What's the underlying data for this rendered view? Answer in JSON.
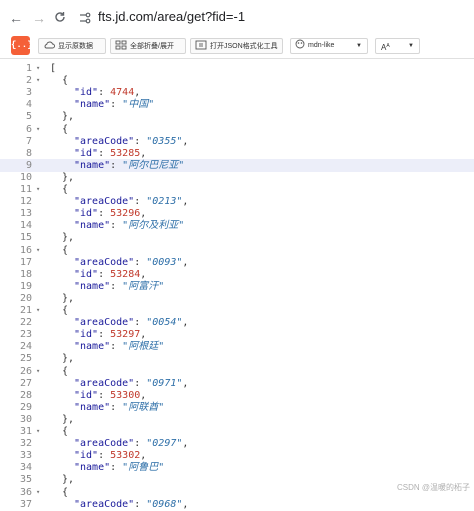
{
  "browser": {
    "url": "fts.jd.com/area/get?fid=-1"
  },
  "toolbar": {
    "logo_text": "{..}",
    "btn_raw": "显示原数据",
    "btn_fold": "全部折叠/展开",
    "btn_tool": "打开JSON格式化工具",
    "theme_select": "mdn-like",
    "font_select": "A"
  },
  "editor": {
    "lines": [
      {
        "n": "1",
        "fold": "▾",
        "ind": 0,
        "t": [
          {
            "c": "p",
            "v": "["
          }
        ]
      },
      {
        "n": "2",
        "fold": "▾",
        "ind": 1,
        "t": [
          {
            "c": "p",
            "v": "{"
          }
        ]
      },
      {
        "n": "3",
        "fold": "",
        "ind": 2,
        "t": [
          {
            "c": "k",
            "v": "\"id\""
          },
          {
            "c": "p",
            "v": ": "
          },
          {
            "c": "n",
            "v": "4744"
          },
          {
            "c": "p",
            "v": ","
          }
        ]
      },
      {
        "n": "4",
        "fold": "",
        "ind": 2,
        "t": [
          {
            "c": "k",
            "v": "\"name\""
          },
          {
            "c": "p",
            "v": ": "
          },
          {
            "c": "s",
            "v": "\"中国\""
          }
        ]
      },
      {
        "n": "5",
        "fold": "",
        "ind": 1,
        "t": [
          {
            "c": "p",
            "v": "},"
          }
        ]
      },
      {
        "n": "6",
        "fold": "▾",
        "ind": 1,
        "t": [
          {
            "c": "p",
            "v": "{"
          }
        ]
      },
      {
        "n": "7",
        "fold": "",
        "ind": 2,
        "t": [
          {
            "c": "k",
            "v": "\"areaCode\""
          },
          {
            "c": "p",
            "v": ": "
          },
          {
            "c": "s",
            "v": "\"0355\""
          },
          {
            "c": "p",
            "v": ","
          }
        ]
      },
      {
        "n": "8",
        "fold": "",
        "ind": 2,
        "t": [
          {
            "c": "k",
            "v": "\"id\""
          },
          {
            "c": "p",
            "v": ": "
          },
          {
            "c": "n",
            "v": "53285"
          },
          {
            "c": "p",
            "v": ","
          }
        ]
      },
      {
        "n": "9",
        "fold": "",
        "ind": 2,
        "hl": true,
        "t": [
          {
            "c": "k",
            "v": "\"name\""
          },
          {
            "c": "p",
            "v": ": "
          },
          {
            "c": "s",
            "v": "\"阿尔巴尼亚\""
          }
        ]
      },
      {
        "n": "10",
        "fold": "",
        "ind": 1,
        "t": [
          {
            "c": "p",
            "v": "},"
          }
        ]
      },
      {
        "n": "11",
        "fold": "▾",
        "ind": 1,
        "t": [
          {
            "c": "p",
            "v": "{"
          }
        ]
      },
      {
        "n": "12",
        "fold": "",
        "ind": 2,
        "t": [
          {
            "c": "k",
            "v": "\"areaCode\""
          },
          {
            "c": "p",
            "v": ": "
          },
          {
            "c": "s",
            "v": "\"0213\""
          },
          {
            "c": "p",
            "v": ","
          }
        ]
      },
      {
        "n": "13",
        "fold": "",
        "ind": 2,
        "t": [
          {
            "c": "k",
            "v": "\"id\""
          },
          {
            "c": "p",
            "v": ": "
          },
          {
            "c": "n",
            "v": "53296"
          },
          {
            "c": "p",
            "v": ","
          }
        ]
      },
      {
        "n": "14",
        "fold": "",
        "ind": 2,
        "t": [
          {
            "c": "k",
            "v": "\"name\""
          },
          {
            "c": "p",
            "v": ": "
          },
          {
            "c": "s",
            "v": "\"阿尔及利亚\""
          }
        ]
      },
      {
        "n": "15",
        "fold": "",
        "ind": 1,
        "t": [
          {
            "c": "p",
            "v": "},"
          }
        ]
      },
      {
        "n": "16",
        "fold": "▾",
        "ind": 1,
        "t": [
          {
            "c": "p",
            "v": "{"
          }
        ]
      },
      {
        "n": "17",
        "fold": "",
        "ind": 2,
        "t": [
          {
            "c": "k",
            "v": "\"areaCode\""
          },
          {
            "c": "p",
            "v": ": "
          },
          {
            "c": "s",
            "v": "\"0093\""
          },
          {
            "c": "p",
            "v": ","
          }
        ]
      },
      {
        "n": "18",
        "fold": "",
        "ind": 2,
        "t": [
          {
            "c": "k",
            "v": "\"id\""
          },
          {
            "c": "p",
            "v": ": "
          },
          {
            "c": "n",
            "v": "53284"
          },
          {
            "c": "p",
            "v": ","
          }
        ]
      },
      {
        "n": "19",
        "fold": "",
        "ind": 2,
        "t": [
          {
            "c": "k",
            "v": "\"name\""
          },
          {
            "c": "p",
            "v": ": "
          },
          {
            "c": "s",
            "v": "\"阿富汗\""
          }
        ]
      },
      {
        "n": "20",
        "fold": "",
        "ind": 1,
        "t": [
          {
            "c": "p",
            "v": "},"
          }
        ]
      },
      {
        "n": "21",
        "fold": "▾",
        "ind": 1,
        "t": [
          {
            "c": "p",
            "v": "{"
          }
        ]
      },
      {
        "n": "22",
        "fold": "",
        "ind": 2,
        "t": [
          {
            "c": "k",
            "v": "\"areaCode\""
          },
          {
            "c": "p",
            "v": ": "
          },
          {
            "c": "s",
            "v": "\"0054\""
          },
          {
            "c": "p",
            "v": ","
          }
        ]
      },
      {
        "n": "23",
        "fold": "",
        "ind": 2,
        "t": [
          {
            "c": "k",
            "v": "\"id\""
          },
          {
            "c": "p",
            "v": ": "
          },
          {
            "c": "n",
            "v": "53297"
          },
          {
            "c": "p",
            "v": ","
          }
        ]
      },
      {
        "n": "24",
        "fold": "",
        "ind": 2,
        "t": [
          {
            "c": "k",
            "v": "\"name\""
          },
          {
            "c": "p",
            "v": ": "
          },
          {
            "c": "s",
            "v": "\"阿根廷\""
          }
        ]
      },
      {
        "n": "25",
        "fold": "",
        "ind": 1,
        "t": [
          {
            "c": "p",
            "v": "},"
          }
        ]
      },
      {
        "n": "26",
        "fold": "▾",
        "ind": 1,
        "t": [
          {
            "c": "p",
            "v": "{"
          }
        ]
      },
      {
        "n": "27",
        "fold": "",
        "ind": 2,
        "t": [
          {
            "c": "k",
            "v": "\"areaCode\""
          },
          {
            "c": "p",
            "v": ": "
          },
          {
            "c": "s",
            "v": "\"0971\""
          },
          {
            "c": "p",
            "v": ","
          }
        ]
      },
      {
        "n": "28",
        "fold": "",
        "ind": 2,
        "t": [
          {
            "c": "k",
            "v": "\"id\""
          },
          {
            "c": "p",
            "v": ": "
          },
          {
            "c": "n",
            "v": "53300"
          },
          {
            "c": "p",
            "v": ","
          }
        ]
      },
      {
        "n": "29",
        "fold": "",
        "ind": 2,
        "t": [
          {
            "c": "k",
            "v": "\"name\""
          },
          {
            "c": "p",
            "v": ": "
          },
          {
            "c": "s",
            "v": "\"阿联酋\""
          }
        ]
      },
      {
        "n": "30",
        "fold": "",
        "ind": 1,
        "t": [
          {
            "c": "p",
            "v": "},"
          }
        ]
      },
      {
        "n": "31",
        "fold": "▾",
        "ind": 1,
        "t": [
          {
            "c": "p",
            "v": "{"
          }
        ]
      },
      {
        "n": "32",
        "fold": "",
        "ind": 2,
        "t": [
          {
            "c": "k",
            "v": "\"areaCode\""
          },
          {
            "c": "p",
            "v": ": "
          },
          {
            "c": "s",
            "v": "\"0297\""
          },
          {
            "c": "p",
            "v": ","
          }
        ]
      },
      {
        "n": "33",
        "fold": "",
        "ind": 2,
        "t": [
          {
            "c": "k",
            "v": "\"id\""
          },
          {
            "c": "p",
            "v": ": "
          },
          {
            "c": "n",
            "v": "53302"
          },
          {
            "c": "p",
            "v": ","
          }
        ]
      },
      {
        "n": "34",
        "fold": "",
        "ind": 2,
        "t": [
          {
            "c": "k",
            "v": "\"name\""
          },
          {
            "c": "p",
            "v": ": "
          },
          {
            "c": "s",
            "v": "\"阿鲁巴\""
          }
        ]
      },
      {
        "n": "35",
        "fold": "",
        "ind": 1,
        "t": [
          {
            "c": "p",
            "v": "},"
          }
        ]
      },
      {
        "n": "36",
        "fold": "▾",
        "ind": 1,
        "t": [
          {
            "c": "p",
            "v": "{"
          }
        ]
      },
      {
        "n": "37",
        "fold": "",
        "ind": 2,
        "t": [
          {
            "c": "k",
            "v": "\"areaCode\""
          },
          {
            "c": "p",
            "v": ": "
          },
          {
            "c": "s",
            "v": "\"0968\""
          },
          {
            "c": "p",
            "v": ","
          }
        ]
      }
    ]
  },
  "watermark": "CSDN @温暖的柘子",
  "colors": {
    "logo": "#f56038",
    "key": "#1a1a9a",
    "number": "#c0392b",
    "string": "#2e6fa8",
    "highlight": "#eceef9"
  }
}
